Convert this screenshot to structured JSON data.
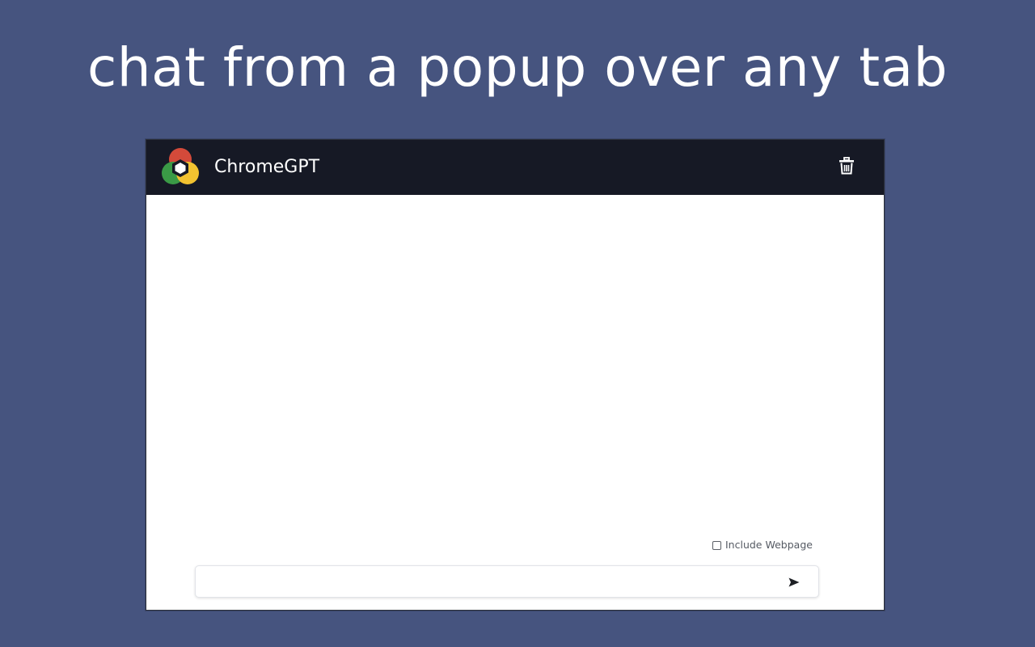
{
  "headline": "chat from a popup over any tab",
  "popup": {
    "app_title": "ChromeGPT",
    "icons": {
      "logo": "chromegpt-logo-icon",
      "delete": "trash-icon",
      "send": "send-icon"
    },
    "include_webpage": {
      "label": "Include Webpage",
      "checked": false
    },
    "message_input": {
      "value": "",
      "placeholder": ""
    }
  },
  "colors": {
    "background": "#46547f",
    "header": "#161925",
    "popup_body": "#ffffff",
    "logo_red": "#d44a3a",
    "logo_green": "#3a9a46",
    "logo_yellow": "#f2c230"
  }
}
